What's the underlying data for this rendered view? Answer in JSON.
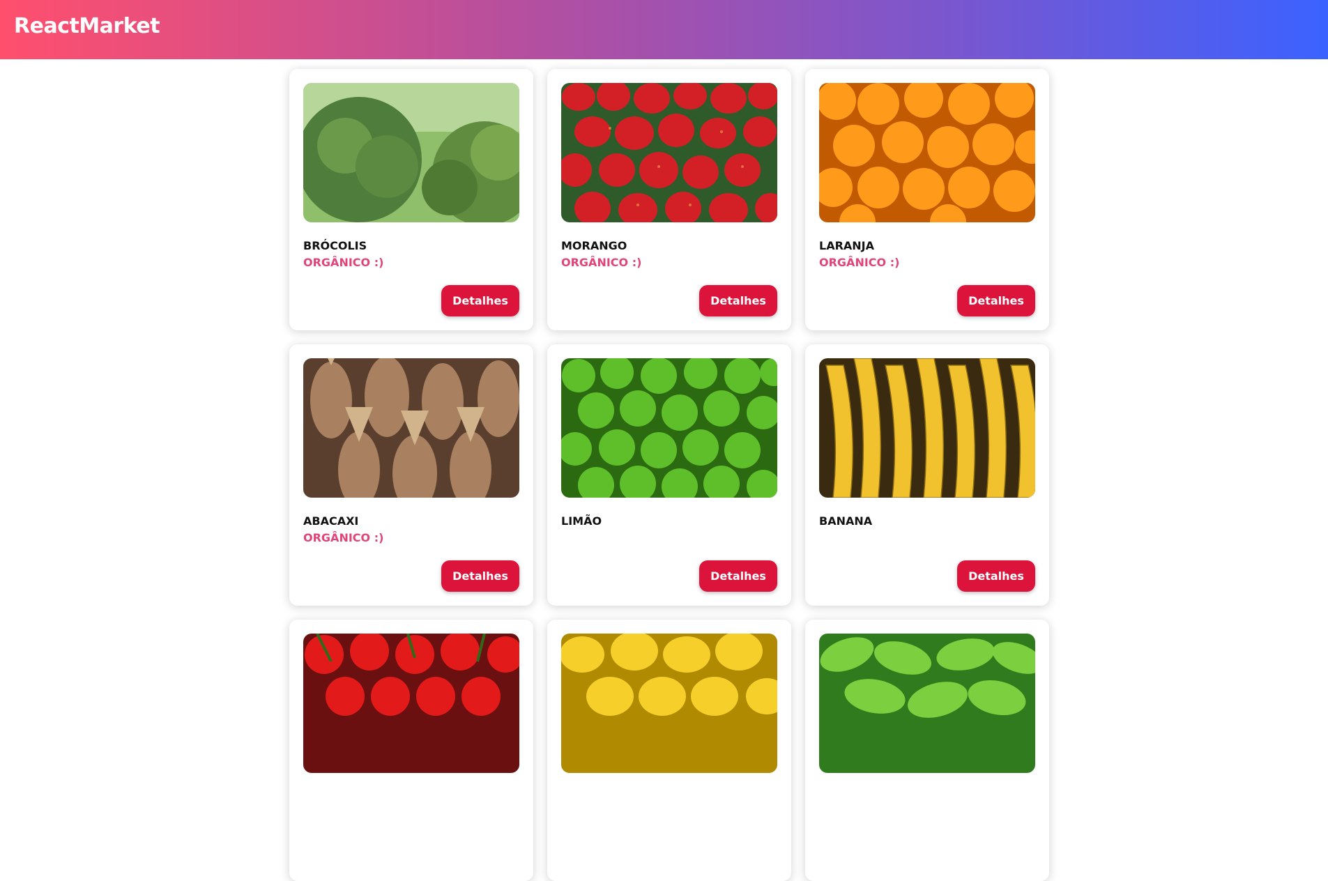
{
  "header": {
    "brand": "ReactMarket"
  },
  "products": [
    {
      "name": "BRÓCOLIS",
      "tag": "ORGÂNICO :)",
      "button": "Detalhes",
      "image_icon": "broccoli"
    },
    {
      "name": "MORANGO",
      "tag": "ORGÂNICO :)",
      "button": "Detalhes",
      "image_icon": "strawberry"
    },
    {
      "name": "LARANJA",
      "tag": "ORGÂNICO :)",
      "button": "Detalhes",
      "image_icon": "orange"
    },
    {
      "name": "ABACAXI",
      "tag": "ORGÂNICO :)",
      "button": "Detalhes",
      "image_icon": "pineapple"
    },
    {
      "name": "LIMÃO",
      "tag": "",
      "button": "Detalhes",
      "image_icon": "lime"
    },
    {
      "name": "BANANA",
      "tag": "",
      "button": "Detalhes",
      "image_icon": "banana"
    },
    {
      "name": "",
      "tag": "",
      "button": "",
      "image_icon": "tomato"
    },
    {
      "name": "",
      "tag": "",
      "button": "",
      "image_icon": "lemon"
    },
    {
      "name": "",
      "tag": "",
      "button": "",
      "image_icon": "spinach"
    }
  ],
  "colors": {
    "accent": "#dc143c",
    "organic": "#e0457a"
  }
}
